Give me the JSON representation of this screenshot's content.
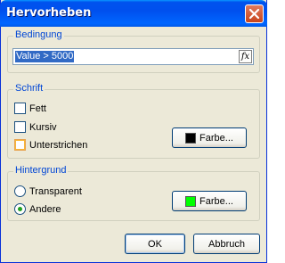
{
  "window": {
    "title": "Hervorheben"
  },
  "bedingung": {
    "legend": "Bedingung",
    "expression": "Value > 5000",
    "fx_label": "fx"
  },
  "schrift": {
    "legend": "Schrift",
    "fett": {
      "label": "Fett",
      "checked": false
    },
    "kursiv": {
      "label": "Kursiv",
      "checked": false
    },
    "unterstrichen": {
      "label": "Unterstrichen",
      "checked": false
    },
    "color_button": {
      "label": "Farbe...",
      "color": "#000000"
    }
  },
  "hintergrund": {
    "legend": "Hintergrund",
    "options": [
      {
        "label": "Transparent",
        "selected": false
      },
      {
        "label": "Andere",
        "selected": true
      }
    ],
    "color_button": {
      "label": "Farbe...",
      "color": "#00ff00"
    }
  },
  "footer": {
    "ok_label": "OK",
    "cancel_label": "Abbruch"
  }
}
